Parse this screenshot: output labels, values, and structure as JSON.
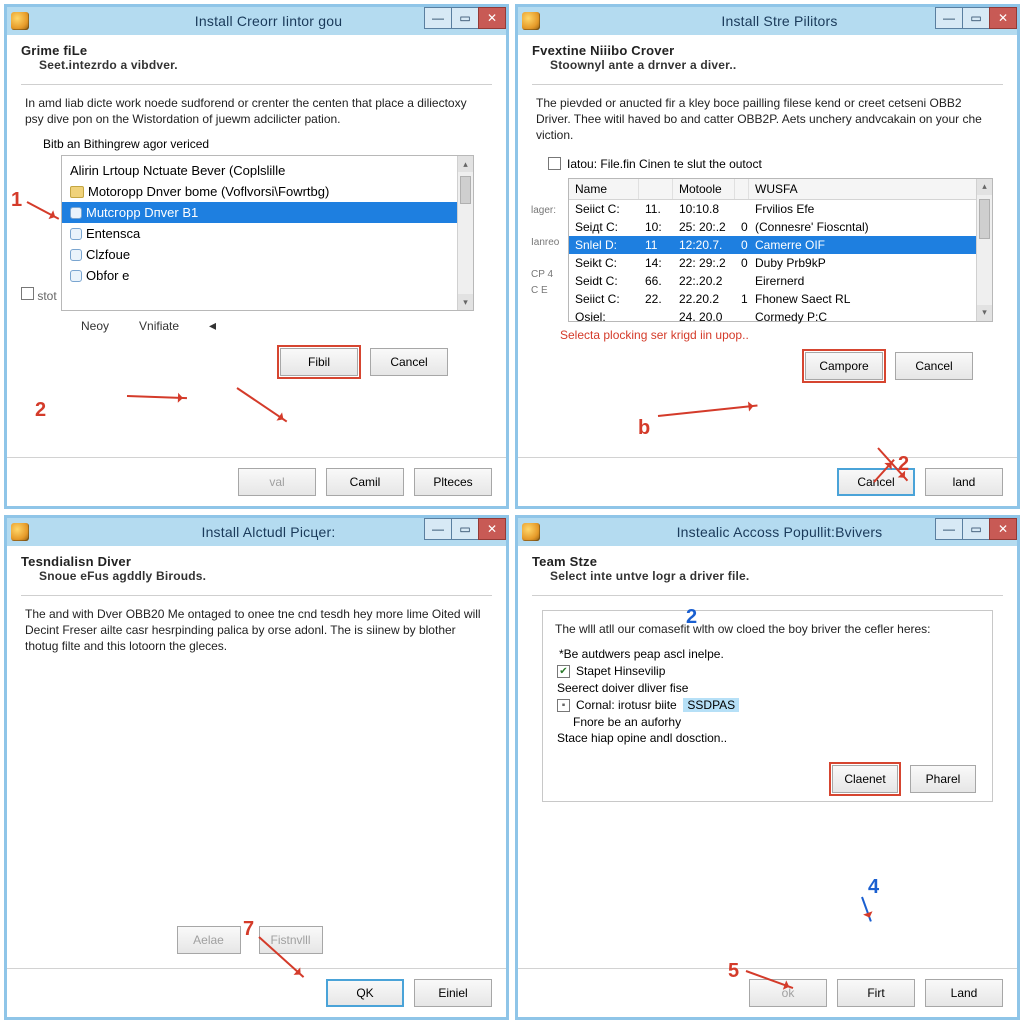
{
  "panes": {
    "tl": {
      "title": "Install  Creorr Iintor gou",
      "h1": "Grime fiLe",
      "h2": "Seet.intezrdo a vibdver.",
      "para": "In amd liab dicte work noede sudforend or crenter the centen that place a diliectoxy psy dive pon on the Wistordation of juewm adcilicter pation.",
      "sublabel": "Bitb an Bithingrew agor vericed",
      "checkbox_left": "stot",
      "list": [
        "Alirin Lrtoup Nctuate Bever (Coplslille",
        "Motoropp Dnver bome (Voflvorsi\\Fоwrtbg)",
        "Мutcгopp Dпvеr В1",
        "Entensca",
        "Clzfoue",
        "Obfor e"
      ],
      "midlabel1": "Neoy",
      "midlabel2": "Vnifiate",
      "btn_primary": "Fibil",
      "btn_cancel": "Cancel",
      "foot_1": "val",
      "foot_2": "Camil",
      "foot_3": "Plteces",
      "ann1": "1",
      "ann2": "2"
    },
    "tr": {
      "title": "Install  Stre  Pilitors",
      "h1": "Fvextine Niiibo Crover",
      "h2": "Stoоwnyl ante a drnver a diver..",
      "para": "The pievded or anucted fir a kley boce pailling filese kend or creet cetseni OBB2 Driver.  Thee witil haved bo and catter OBB2P. Aets unchery andvcakain on your che viction.",
      "chk_label": "Iatou: File.fin Cinen te slut the outoct",
      "headers": {
        "a": "Name",
        "c": "Motoole",
        "e": "WUSFA"
      },
      "rows": [
        {
          "a": "Seiict C:",
          "b": "11.",
          "c": "10:10.8",
          "d": "",
          "e": "Frvilios Efe"
        },
        {
          "a": "Seiдt C:",
          "b": "10:",
          "c": "25: 20:.2",
          "d": "0",
          "e": "(Connesre' Fioscntal)"
        },
        {
          "a": "Snlel D:",
          "b": "11",
          "c": "12:20.7.",
          "d": "0",
          "e": "Camerre OIF"
        },
        {
          "a": "Seikt C:",
          "b": "14:",
          "c": "22: 29:.2",
          "d": "0",
          "e": "Duby Prb9kP"
        },
        {
          "a": "Seidt C:",
          "b": "66.",
          "c": "22:.20.2",
          "d": "",
          "e": "Eirernerd"
        },
        {
          "a": "Seiict C:",
          "b": "22.",
          "c": "22.20.2",
          "d": "1",
          "e": "Fhonew Saect RL"
        },
        {
          "a": "Osiel:",
          "b": "",
          "c": "24. 20.0",
          "d": "",
          "e": "Cormedy P:C"
        }
      ],
      "leftlabels": "lager:\n\nIanreo \n\nCP 4\nС Е",
      "redtext": "Selecta plocking ser krigd iin upop..",
      "btn_primary": "Campore",
      "btn_cancel": "Cancel",
      "foot_cancel": "Cancel",
      "foot_land": "land",
      "annb": "b",
      "ann2": "2"
    },
    "bl": {
      "title": "Install  Alctudl Picцer:",
      "h1": "Tesndialisn Diver",
      "h2": "Snoue eFus agddly Birouds.",
      "para": "The and with Dver OBB20 Me ontaged to onee tne cnd tesdh hey more lime Oited will Decint Freser ailte casr hesrpinding palica by orse adonl. The is siinew by blother thotug filte and this lotoorn the gleces.",
      "mid_a": "Aelae",
      "mid_b": "Fistnvlll",
      "foot_ok": "QK",
      "foot_cancel": "Einiel",
      "ann7": "7"
    },
    "br": {
      "title": "Instealic Accoss Popullit:Bvivers",
      "h1": "Team Stze",
      "h2": "Select inte untve logr a driver file.",
      "inner_para": "The wlll atll our comasefit wlth ow cloed the boy briver the cefler heres:",
      "bullet1": "Be autdwers peap ascl inelpe.",
      "chk1": "Stapet Hinsevilip",
      "plain1": "Seerect doiver dliver fise",
      "chk2_a": "Cornal: irotusr biite",
      "chk2_b": "SSDPAS",
      "plain2": "Fnore be an auforhy",
      "plain3": "Stace hiap opine andl dosction..",
      "inner_btn1": "Claenet",
      "inner_btn2": "Pharel",
      "foot_1": "ok",
      "foot_2": "Firt",
      "foot_3": "Land",
      "ann2": "2",
      "ann4": "4",
      "ann5": "5"
    }
  }
}
